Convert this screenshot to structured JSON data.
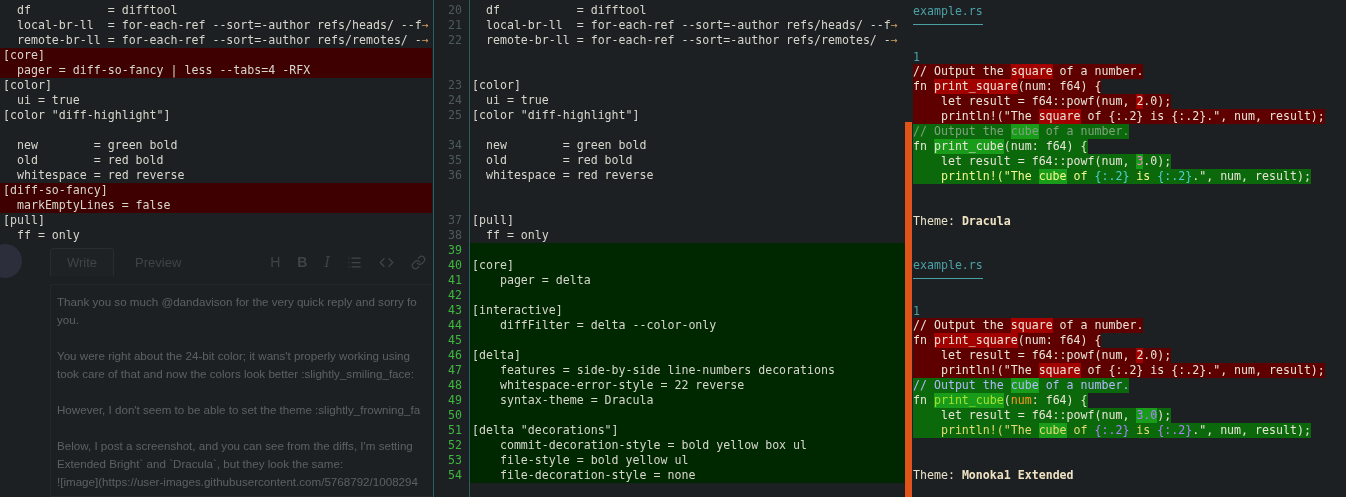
{
  "diff_rows": [
    {
      "left": {
        "kind": "context",
        "text": "  df           = difftool"
      },
      "right": {
        "kind": "context",
        "number": "20",
        "text": "  df           = difftool"
      }
    },
    {
      "left": {
        "kind": "context",
        "text": "  local-br-ll  = for-each-ref --sort=-author refs/heads/ --f",
        "wrap": "→"
      },
      "right": {
        "kind": "context",
        "number": "21",
        "text": "  local-br-ll  = for-each-ref --sort=-author refs/heads/ --f",
        "wrap": "→"
      }
    },
    {
      "left": {
        "kind": "context",
        "text": "  remote-br-ll = for-each-ref --sort=-author refs/remotes/ -",
        "wrap": "→"
      },
      "right": {
        "kind": "context",
        "number": "22",
        "text": "  remote-br-ll = for-each-ref --sort=-author refs/remotes/ -",
        "wrap": "→"
      }
    },
    {
      "left": {
        "kind": "removed",
        "text": "[core]"
      },
      "right": {
        "kind": "empty"
      }
    },
    {
      "left": {
        "kind": "removed",
        "text": "  pager = diff-so-fancy | less --tabs=4 -RFX"
      },
      "right": {
        "kind": "empty"
      }
    },
    {
      "left": {
        "kind": "context",
        "text": "[color]"
      },
      "right": {
        "kind": "context",
        "number": "23",
        "text": "[color]"
      }
    },
    {
      "left": {
        "kind": "context",
        "text": "  ui = true"
      },
      "right": {
        "kind": "context",
        "number": "24",
        "text": "  ui = true"
      }
    },
    {
      "left": {
        "kind": "context",
        "text": "[color \"diff-highlight\"]"
      },
      "right": {
        "kind": "context",
        "number": "25",
        "text": "[color \"diff-highlight\"]"
      }
    },
    {
      "left": {
        "kind": "empty"
      },
      "right": {
        "kind": "empty"
      }
    },
    {
      "left": {
        "kind": "context",
        "text": "  new        = green bold"
      },
      "right": {
        "kind": "context",
        "number": "34",
        "text": "  new        = green bold"
      }
    },
    {
      "left": {
        "kind": "context",
        "text": "  old        = red bold"
      },
      "right": {
        "kind": "context",
        "number": "35",
        "text": "  old        = red bold"
      }
    },
    {
      "left": {
        "kind": "context",
        "text": "  whitespace = red reverse"
      },
      "right": {
        "kind": "context",
        "number": "36",
        "text": "  whitespace = red reverse"
      }
    },
    {
      "left": {
        "kind": "removed",
        "text": "[diff-so-fancy]"
      },
      "right": {
        "kind": "empty"
      }
    },
    {
      "left": {
        "kind": "removed",
        "text": "  markEmptyLines = false"
      },
      "right": {
        "kind": "empty"
      }
    },
    {
      "left": {
        "kind": "context",
        "text": "[pull]"
      },
      "right": {
        "kind": "context",
        "number": "37",
        "text": "[pull]"
      }
    },
    {
      "left": {
        "kind": "context",
        "text": "  ff = only"
      },
      "right": {
        "kind": "context",
        "number": "38",
        "text": "  ff = only"
      }
    },
    {
      "right": {
        "kind": "added",
        "number": "39"
      }
    },
    {
      "right": {
        "kind": "added",
        "number": "40",
        "text": "[core]"
      }
    },
    {
      "right": {
        "kind": "added",
        "number": "41",
        "text": "    pager = delta"
      }
    },
    {
      "right": {
        "kind": "added",
        "number": "42"
      }
    },
    {
      "right": {
        "kind": "added",
        "number": "43",
        "text": "[interactive]"
      }
    },
    {
      "right": {
        "kind": "added",
        "number": "44",
        "text": "    diffFilter = delta --color-only"
      }
    },
    {
      "right": {
        "kind": "added",
        "number": "45"
      }
    },
    {
      "right": {
        "kind": "added",
        "number": "46",
        "text": "[delta]"
      }
    },
    {
      "right": {
        "kind": "added",
        "number": "47",
        "text": "    features = side-by-side line-numbers decorations"
      }
    },
    {
      "right": {
        "kind": "added",
        "number": "48",
        "text": "    whitespace-error-style = 22 reverse"
      }
    },
    {
      "right": {
        "kind": "added",
        "number": "49",
        "text": "    syntax-theme = Dracula"
      }
    },
    {
      "right": {
        "kind": "added",
        "number": "50"
      }
    },
    {
      "right": {
        "kind": "added",
        "number": "51",
        "text": "[delta \"decorations\"]"
      }
    },
    {
      "right": {
        "kind": "added",
        "number": "52",
        "text": "    commit-decoration-style = bold yellow box ul"
      }
    },
    {
      "right": {
        "kind": "added",
        "number": "53",
        "text": "    file-style = bold yellow ul"
      }
    },
    {
      "right": {
        "kind": "added",
        "number": "54",
        "text": "    file-decoration-style = none"
      }
    }
  ],
  "comment_editor": {
    "tabs": [
      {
        "label": "Write",
        "selected": true
      },
      {
        "label": "Preview",
        "selected": false
      }
    ],
    "toolbar": [
      {
        "kind": "text",
        "label": "H"
      },
      {
        "kind": "text",
        "label": "B",
        "bold": true
      },
      {
        "kind": "text",
        "label": "I",
        "italic": true
      },
      {
        "kind": "list"
      },
      {
        "kind": "code"
      },
      {
        "kind": "link"
      }
    ],
    "paragraphs": [
      [
        "Thank you so much @dandavison for the very quick reply and sorry fo",
        "you."
      ],
      [
        "You were right about the 24-bit color; it wans't properly working using",
        "took care of that and now the colors look better :slightly_smiling_face:"
      ],
      [
        "However, I don't seem to be able to set the theme :slightly_frowning_fa"
      ],
      [
        "Below, I post a screenshot, and you can see from the diffs, I'm setting",
        "Extended Bright` and `Dracula`, but they look the same:",
        "![image](https://user-images.githubusercontent.com/5768792/1008294"
      ]
    ]
  },
  "previews": [
    {
      "file": "example.rs",
      "line_number": "1",
      "theme_label": "Theme:",
      "theme": "Dracula",
      "kind": "dracula",
      "lines": [
        {
          "kind": "removed",
          "segments": [
            {
              "text": "// Output the "
            },
            {
              "text": "square",
              "hl": true
            },
            {
              "text": " of a number."
            }
          ]
        },
        {
          "kind": "removed",
          "segments": [
            {
              "text": "fn "
            },
            {
              "text": "print_square",
              "hl": true
            },
            {
              "text": "(num: f64) {"
            }
          ]
        },
        {
          "kind": "removed",
          "segments": [
            {
              "text": "    let result = f64::powf(num, "
            },
            {
              "text": "2",
              "hl": true
            },
            {
              "text": ".0);"
            }
          ]
        },
        {
          "kind": "removed",
          "segments": [
            {
              "text": "    println!(\"The "
            },
            {
              "text": "square",
              "hl": true
            },
            {
              "text": " of {:.2} is {:.2}.\", num, result);"
            }
          ]
        },
        {
          "kind": "added",
          "segments": [
            {
              "text": "// Output the ",
              "kind": "comment"
            },
            {
              "text": "cube",
              "hl": true,
              "kind": "comment"
            },
            {
              "text": " of a number.",
              "kind": "comment"
            }
          ]
        },
        {
          "kind": "added",
          "segments": [
            {
              "text": "fn "
            },
            {
              "text": "print_cube",
              "hl": true
            },
            {
              "text": "(num: f64) {"
            }
          ]
        },
        {
          "kind": "added",
          "segments": [
            {
              "text": "    let result = f64::powf(num, "
            },
            {
              "text": "3",
              "hl": true,
              "kind": "number"
            },
            {
              "text": ".0);"
            }
          ]
        },
        {
          "kind": "added",
          "segments": [
            {
              "text": "    println!(\"The ",
              "kind": "string"
            },
            {
              "text": "cube",
              "hl": true,
              "kind": "string"
            },
            {
              "text": " of ",
              "kind": "string"
            },
            {
              "text": "{:.2}",
              "kind": "format"
            },
            {
              "text": " is ",
              "kind": "string"
            },
            {
              "text": "{:.2}",
              "kind": "format"
            },
            {
              "text": ".\", num, result);"
            }
          ]
        }
      ]
    },
    {
      "file": "example.rs",
      "line_number": "1",
      "theme_label": "Theme:",
      "theme": "Monoka1 Extended",
      "kind": "monokai",
      "lines": [
        {
          "kind": "removed",
          "segments": [
            {
              "text": "// Output the "
            },
            {
              "text": "square",
              "hl": true
            },
            {
              "text": " of a number."
            }
          ]
        },
        {
          "kind": "removed",
          "segments": [
            {
              "text": "fn "
            },
            {
              "text": "print_square",
              "hl": true
            },
            {
              "text": "(num: f64) {"
            }
          ]
        },
        {
          "kind": "removed",
          "segments": [
            {
              "text": "    let result = f64::powf(num, "
            },
            {
              "text": "2",
              "hl": true
            },
            {
              "text": ".0);"
            }
          ]
        },
        {
          "kind": "removed",
          "segments": [
            {
              "text": "    println!(\"The "
            },
            {
              "text": "square",
              "hl": true
            },
            {
              "text": " of {:.2} is {:.2}.\", num, result);"
            }
          ]
        },
        {
          "kind": "added",
          "segments": [
            {
              "text": "// Output the ",
              "kind": "comment"
            },
            {
              "text": "cube",
              "hl": true,
              "kind": "comment"
            },
            {
              "text": " of a number.",
              "kind": "comment"
            }
          ]
        },
        {
          "kind": "added",
          "segments": [
            {
              "text": "fn "
            },
            {
              "text": "print_cube",
              "hl": true,
              "kind": "function"
            },
            {
              "text": "("
            },
            {
              "text": "num",
              "kind": "param"
            },
            {
              "text": ": f64) {"
            }
          ]
        },
        {
          "kind": "added",
          "segments": [
            {
              "text": "    let result = f64::powf(num, "
            },
            {
              "text": "3.0",
              "hl": true,
              "kind": "number"
            },
            {
              "text": ");"
            }
          ]
        },
        {
          "kind": "added",
          "segments": [
            {
              "text": "    println!(\"The ",
              "kind": "string"
            },
            {
              "text": "cube",
              "hl": true,
              "kind": "string"
            },
            {
              "text": " of ",
              "kind": "string"
            },
            {
              "text": "{:.2}",
              "kind": "format"
            },
            {
              "text": " is ",
              "kind": "string"
            },
            {
              "text": "{:.2}",
              "kind": "format"
            },
            {
              "text": ".\", num, result);"
            }
          ]
        }
      ]
    }
  ]
}
